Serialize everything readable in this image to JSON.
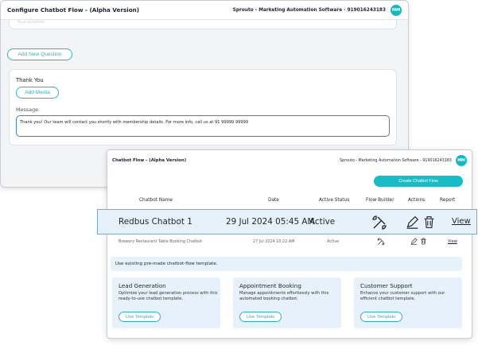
{
  "back_window": {
    "title": "Configure Chatbot Flow - (Alpha Version)",
    "company": "Sprouto - Marketing Automation Software - 919016243183",
    "avatar": "MM",
    "question_placeholder": "Your question",
    "add_question_label": "Add New Question",
    "thank_you_title": "Thank You",
    "add_media_label": "Add Media",
    "message_label": "Message:",
    "message_value": "Thank you! Our team will contact you shortly with membership details. For more info, call us at 91 99999 99999"
  },
  "front_window": {
    "title": "Chatbot Flow - (Alpha Version)",
    "company": "Sprouto - Marketing Automation Software - 919016243183",
    "avatar": "MM",
    "create_label": "Create Chatbot Flow",
    "columns": [
      "Chatbot Name",
      "Date",
      "Active Status",
      "Flow Builder",
      "Actions",
      "Report"
    ],
    "rows": [
      {
        "name": "Redbus Chatbot 1",
        "date": "29 Jul 2024 05:45 AM",
        "status": "Active",
        "report": "View"
      },
      {
        "name": "Brewery Restaurant Table Booking Chatbot",
        "date": "27 Jul 2024 10:22 AM",
        "status": "Active",
        "report": "View"
      }
    ],
    "banner": "Use existing pre-made chatbot-flow template.",
    "templates": [
      {
        "title": "Lead Generation",
        "desc": "Optimize your lead generation process with this ready-to-use chatbot template.",
        "button": "Use Template"
      },
      {
        "title": "Appointment Booking",
        "desc": "Manage appointments effortlessly with this automated booking chatbot.",
        "button": "Use Template"
      },
      {
        "title": "Customer Support",
        "desc": "Enhance your customer support with our efficient chatbot template.",
        "button": "Use Template"
      }
    ]
  },
  "icons": {
    "flow_builder": "tools-icon",
    "edit": "pencil-icon",
    "delete": "trash-icon"
  },
  "colors": {
    "accent": "#19bcc6",
    "highlight_bg": "#e6f1fb",
    "highlight_border": "#7ea5ce"
  }
}
